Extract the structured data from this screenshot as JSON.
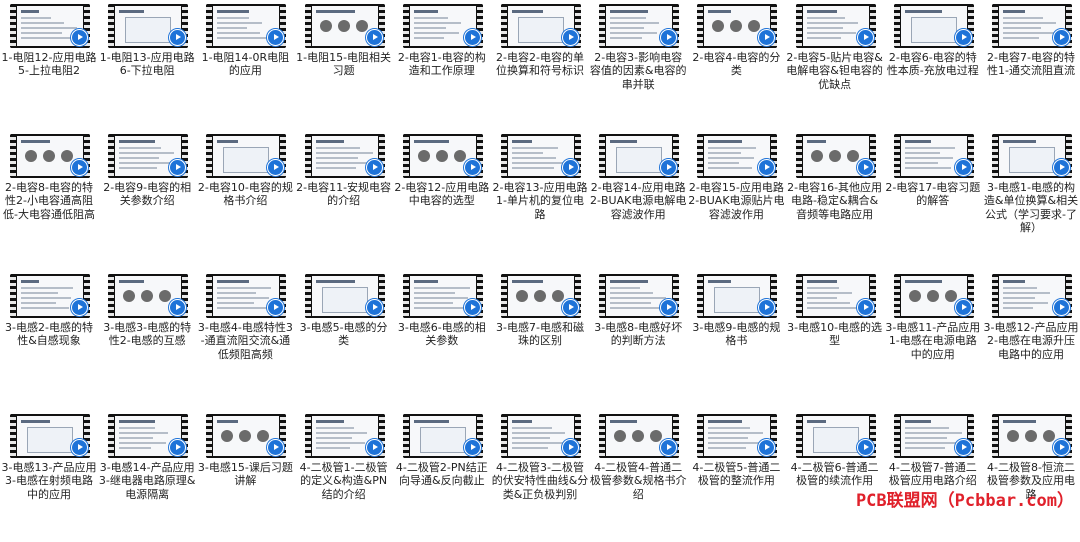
{
  "files": [
    "1-电阻12-应用电路5-上拉电阻2",
    "1-电阻13-应用电路6-下拉电阻",
    "1-电阻14-0R电阻的应用",
    "1-电阻15-电阻相关习题",
    "2-电容1-电容的构造和工作原理",
    "2-电容2-电容的单位换算和符号标识",
    "2-电容3-影响电容容值的因素&电容的串并联",
    "2-电容4-电容的分类",
    "2-电容5-贴片电容&电解电容&钽电容的优缺点",
    "2-电容6-电容的特性本质-充放电过程",
    "2-电容7-电容的特性1-通交流阻直流",
    "2-电容8-电容的特性2-小电容通高阻低-大电容通低阻高",
    "2-电容9-电容的相关参数介绍",
    "2-电容10-电容的规格书介绍",
    "2-电容11-安规电容的介绍",
    "2-电容12-应用电路中电容的选型",
    "2-电容13-应用电路1-单片机的复位电路",
    "2-电容14-应用电路2-BUAK电源电解电容滤波作用",
    "2-电容15-应用电路2-BUAK电源贴片电容滤波作用",
    "2-电容16-其他应用电路-稳定&耦合&音频等电路应用",
    "2-电容17-电容习题的解答",
    "3-电感1-电感的构造&单位换算&相关公式（学习要求-了解）",
    "3-电感2-电感的特性&自感现象",
    "3-电感3-电感的特性2-电感的互感",
    "3-电感4-电感特性3-通直流阻交流&通低频阻高频",
    "3-电感5-电感的分类",
    "3-电感6-电感的相关参数",
    "3-电感7-电感和磁珠的区别",
    "3-电感8-电感好坏的判断方法",
    "3-电感9-电感的规格书",
    "3-电感10-电感的选型",
    "3-电感11-产品应用1-电感在电源电路中的应用",
    "3-电感12-产品应用2-电感在电源升压电路中的应用",
    "3-电感13-产品应用3-电感在射频电路中的应用",
    "3-电感14-产品应用3-继电器电路原理&电源隔离",
    "3-电感15-课后习题讲解",
    "4-二极管1-二极管的定义&构造&PN结的介绍",
    "4-二极管2-PN结正向导通&反向截止",
    "4-二极管3-二极管的伏安特性曲线&分类&正负极判别",
    "4-二极管4-普通二极管参数&规格书介绍",
    "4-二极管5-普通二极管的整流作用",
    "4-二极管6-普通二极管的续流作用",
    "4-二极管7-普通二极管应用电路介绍",
    "4-二极管8-恒流二极管参数及应用电路"
  ],
  "watermark": "PCB联盟网（Pcbbar.com）",
  "colors": {
    "play_badge": "#1e73d8",
    "watermark": "#e0212b"
  },
  "icons": {
    "thumbnail_badge": "play-icon"
  }
}
